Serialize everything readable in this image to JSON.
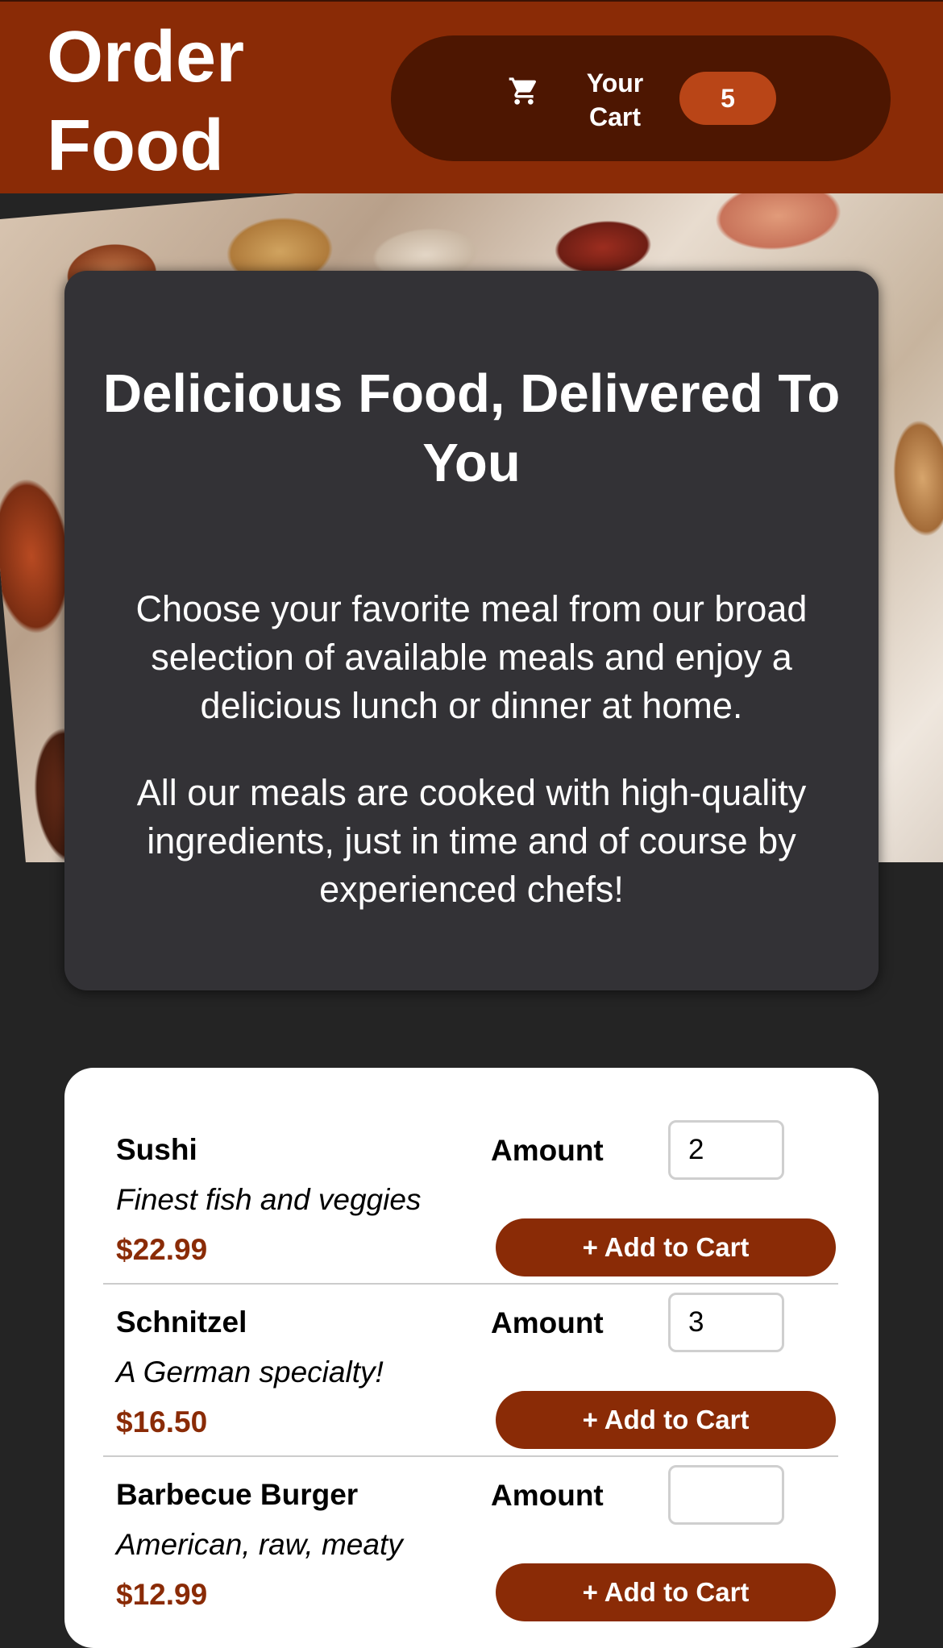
{
  "header": {
    "title": "Order Food",
    "cart_label": "Your Cart",
    "cart_count": "5",
    "cart_icon": "shopping-cart-icon"
  },
  "summary": {
    "heading": "Delicious Food, Delivered To You",
    "paragraph_1": "Choose your favorite meal from our broad selection of available meals and enjoy a delicious lunch or dinner at home.",
    "paragraph_2": "All our meals are cooked with high-quality ingredients, just in time and of course by experienced chefs!"
  },
  "meals": [
    {
      "name": "Sushi",
      "description": "Finest fish and veggies",
      "price": "$22.99",
      "amount_label": "Amount",
      "amount_value": "2",
      "button_label": "+ Add to Cart"
    },
    {
      "name": "Schnitzel",
      "description": "A German specialty!",
      "price": "$16.50",
      "amount_label": "Amount",
      "amount_value": "3",
      "button_label": "+ Add to Cart"
    },
    {
      "name": "Barbecue Burger",
      "description": "American, raw, meaty",
      "price": "$12.99",
      "amount_label": "Amount",
      "amount_value": "",
      "button_label": "+ Add to Cart"
    }
  ],
  "colors": {
    "brand": "#8a2b06",
    "header_button": "#4d1601",
    "badge": "#b94517",
    "page_background": "#242424",
    "summary_card": "#333236"
  }
}
